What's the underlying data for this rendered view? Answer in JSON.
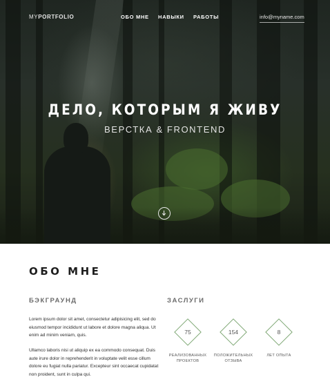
{
  "header": {
    "logo_light": "MY",
    "logo_bold": "PORTFOLIO",
    "nav": [
      "ОБО МНЕ",
      "НАВЫКИ",
      "РАБОТЫ"
    ],
    "email": "info@myname.com"
  },
  "hero": {
    "title": "ДЕЛО, КОТОРЫМ Я ЖИВУ",
    "subtitle": "ВЕРСТКА & FRONTEND",
    "scroll_icon": "arrow-down-circle-icon"
  },
  "about": {
    "title": "ОБО МНЕ",
    "background_title": "БЭКГРАУНД",
    "paragraphs": [
      "Lorem ipsum dolor sit amet, consectetur adipisicing elit, sed do eiusmod tempor incididunt ut labore et dolore magna aliqua. Ut enim ad minim veniam, quis.",
      "Ullamco laboris nisi ut aliquip ex ea commodo consequat. Duis aute irure dolor in reprehenderit in voluptate velit esse cillum dolore eu fugiat nulla pariatur. Excepteur sint occaecat cupidatat non proident, sunt in culpa qui."
    ],
    "stats_title": "ЗАСЛУГИ",
    "stats": [
      {
        "value": "75",
        "label": "Реализованных проектов"
      },
      {
        "value": "154",
        "label": "Положительных отзыва"
      },
      {
        "value": "8",
        "label": "Лет опыта"
      }
    ],
    "accent_color": "#7fa875"
  }
}
